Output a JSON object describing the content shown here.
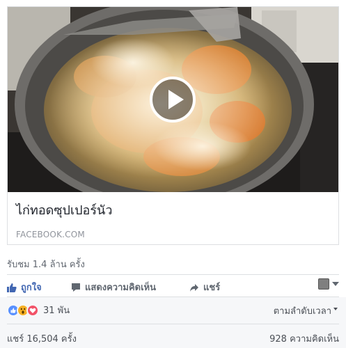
{
  "link_card": {
    "title": "ไก่ทอดซุปเปอร์นัว",
    "domain": "FACEBOOK.COM"
  },
  "video": {
    "play_icon": "play-icon"
  },
  "stats": {
    "views": "รับชม 1.4 ล้าน ครั้ง"
  },
  "actions": {
    "like_label": "ถูกใจ",
    "comment_label": "แสดงความคิดเห็น",
    "share_label": "แชร์"
  },
  "reactions": {
    "icons": [
      "like-reaction-icon",
      "wow-reaction-icon",
      "love-reaction-icon"
    ],
    "count": "31 พัน",
    "sort_label": "ตามลำดับเวลา"
  },
  "footer": {
    "shares": "แชร์ 16,504 ครั้ง",
    "comments": "928 ความคิดเห็น"
  },
  "colors": {
    "accent": "#4267b2",
    "like_reaction": "#5890ff",
    "wow_reaction": "#f7b125",
    "love_reaction": "#f25268"
  }
}
